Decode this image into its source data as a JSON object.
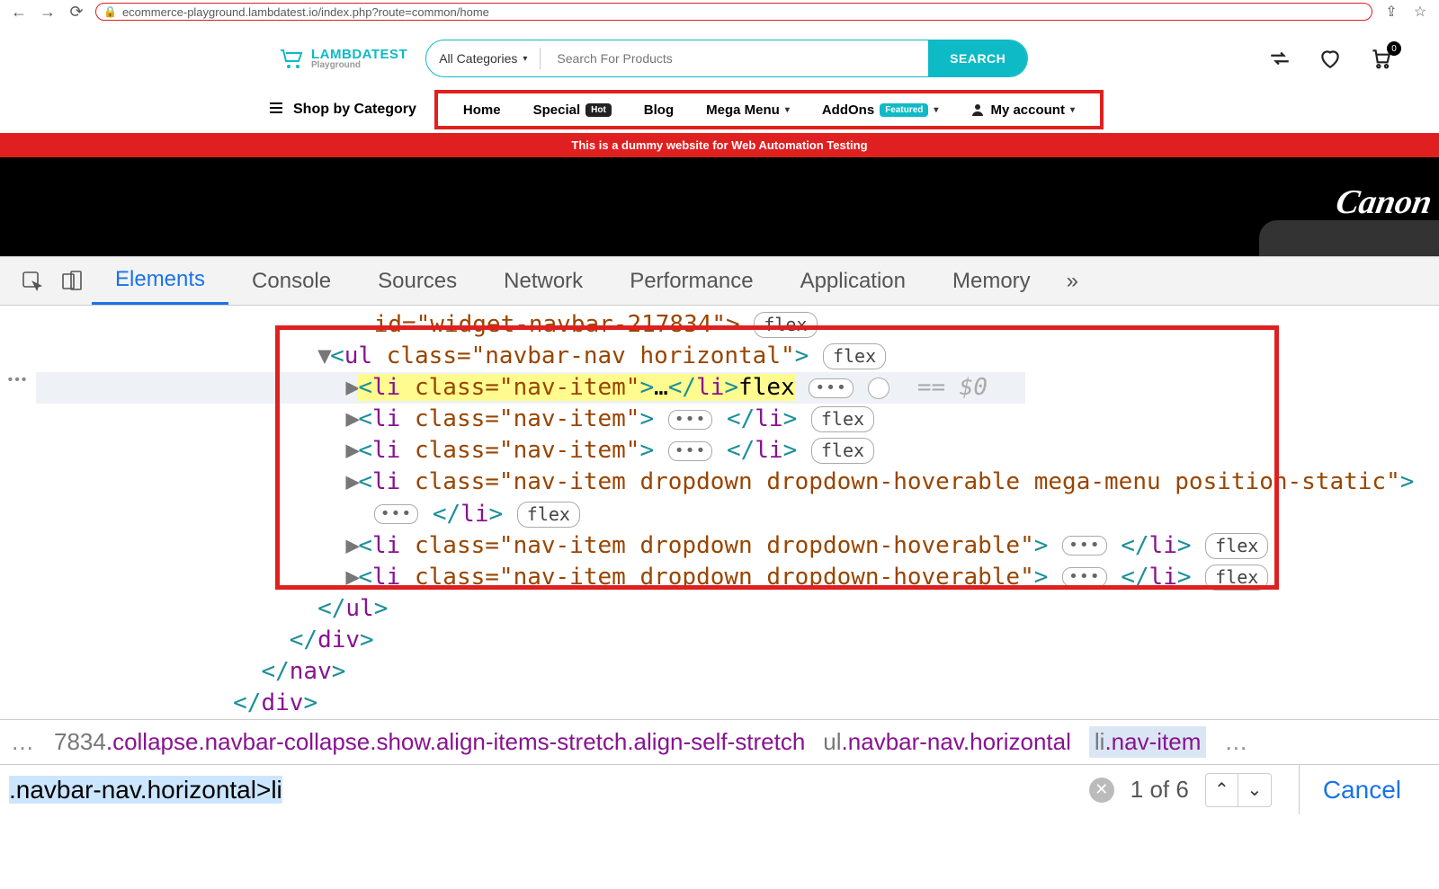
{
  "browser": {
    "url": "ecommerce-playground.lambdatest.io/index.php?route=common/home"
  },
  "site": {
    "logo_top": "LAMBDATEST",
    "logo_sub": "Playground",
    "search": {
      "category": "All Categories",
      "placeholder": "Search For Products",
      "button": "SEARCH"
    },
    "cart_count": "0",
    "shop_by_category": "Shop by Category",
    "nav": {
      "home": "Home",
      "special": "Special",
      "special_badge": "Hot",
      "blog": "Blog",
      "mega": "Mega Menu",
      "addons": "AddOns",
      "addons_badge": "Featured",
      "account": "My account"
    },
    "banner": "This is a dummy website for Web Automation Testing",
    "camera_brand": "Canon"
  },
  "devtools": {
    "tabs": {
      "elements": "Elements",
      "console": "Console",
      "sources": "Sources",
      "network": "Network",
      "performance": "Performance",
      "application": "Application",
      "memory": "Memory"
    },
    "code": {
      "parent_partial": "    id=\"widget-navbar-217834\">",
      "ul_open_prefix": "<",
      "ul_tag": "ul",
      "ul_cls": " class=\"navbar-nav horizontal\"",
      "ul_end": ">",
      "li_basic": "<li class=\"nav-item\">",
      "li_basic_close": "</li>",
      "li_mega": "<li class=\"nav-item dropdown dropdown-hoverable mega-menu position-static\">",
      "li_drop": "<li class=\"nav-item dropdown dropdown-hoverable\">",
      "close_ul": "</ul>",
      "close_div": "</div>",
      "close_nav": "</nav>",
      "eq": "== $0",
      "flex_word": "flex",
      "flex_pill": "flex",
      "dots": "•••"
    },
    "breadcrumb": {
      "prefix_num": "7834",
      "item1": ".collapse.navbar-collapse.show.align-items-stretch.align-self-stretch",
      "item2_tag": "ul",
      "item2_cls": ".navbar-nav.horizontal",
      "item3_tag": "li",
      "item3_cls": ".nav-item"
    },
    "search": {
      "query": ".navbar-nav.horizontal>li",
      "count": "1 of 6",
      "cancel": "Cancel"
    }
  }
}
